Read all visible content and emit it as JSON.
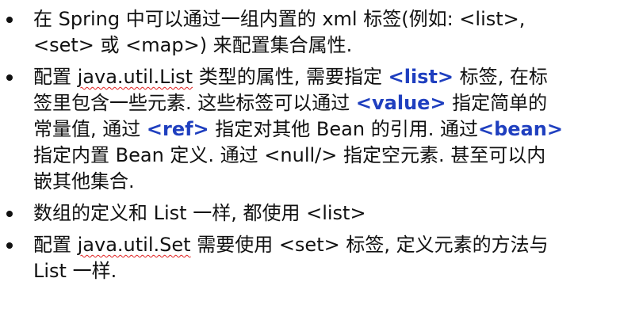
{
  "slide": {
    "bullets": [
      {
        "lines": [
          "在 Spring 中可以通过一组内置的 xml 标签(例如: <list>,",
          "<set> 或 <map>) 来配置集合属性."
        ]
      },
      {
        "l1_a": "配置 ",
        "l1_b": "java.util.List",
        "l1_c": " 类型的属性, 需要指定 ",
        "l1_d": "<list>",
        "l1_e": " 标签, 在标",
        "l2_a": "签里包含一些元素. 这些标签可以通过 ",
        "l2_b": "<value>",
        "l2_c": " 指定简单的",
        "l3_a": "常量值, 通过 ",
        "l3_b": "<ref>",
        "l3_c": " 指定对其他 Bean 的引用. 通过",
        "l3_d": "<bean>",
        "l4": "指定内置 Bean 定义. 通过 <null/> 指定空元素. 甚至可以内",
        "l5": "嵌其他集合."
      },
      {
        "lines": [
          "数组的定义和 List 一样, 都使用 <list>"
        ]
      },
      {
        "l1_a": "配置 ",
        "l1_b": "java.util.Set",
        "l1_c": " 需要使用 <set> 标签, 定义元素的方法与",
        "l2": "List 一样."
      }
    ],
    "colors": {
      "keyword": "#1f3fbf",
      "text": "#111111",
      "spellcheck_underline": "#e02020"
    }
  }
}
